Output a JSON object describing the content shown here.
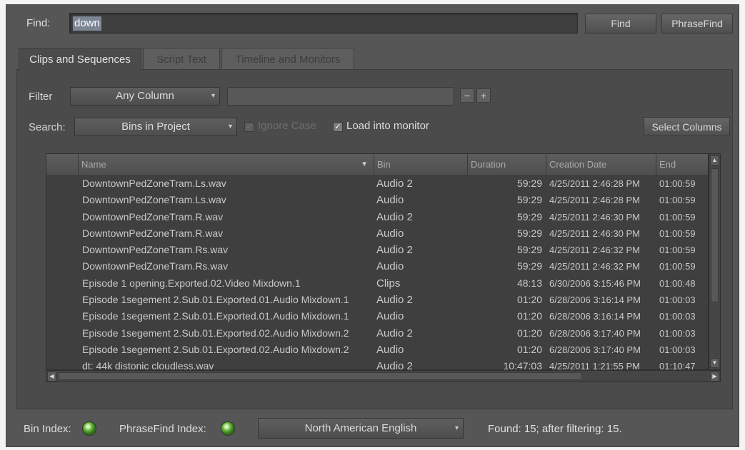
{
  "find": {
    "label": "Find:",
    "value": "down",
    "find_button": "Find",
    "phrasefind_button": "PhraseFind"
  },
  "tabs": [
    {
      "label": "Clips and Sequences",
      "active": true
    },
    {
      "label": "Script Text",
      "active": false
    },
    {
      "label": "Timeline and Monitors",
      "active": false
    }
  ],
  "filter": {
    "label": "Filter",
    "column": "Any Column",
    "text": "",
    "minus": "−",
    "plus": "+"
  },
  "search": {
    "label": "Search:",
    "scope": "Bins in Project",
    "ignore_case": "Ignore Case",
    "load_monitor": "Load into monitor",
    "select_columns": "Select Columns"
  },
  "table": {
    "headers": [
      "Name",
      "Bin",
      "Duration",
      "Creation Date",
      "End"
    ],
    "rows": [
      {
        "icon": "audio",
        "name": "DowntownPedZoneTram.Ls.wav",
        "bin": "Audio 2",
        "duration": "59:29",
        "date": "4/25/2011 2:46:28 PM",
        "end": "01:00:59"
      },
      {
        "icon": "audio",
        "name": "DowntownPedZoneTram.Ls.wav",
        "bin": "Audio",
        "duration": "59:29",
        "date": "4/25/2011 2:46:28 PM",
        "end": "01:00:59"
      },
      {
        "icon": "audio",
        "name": "DowntownPedZoneTram.R.wav",
        "bin": "Audio 2",
        "duration": "59:29",
        "date": "4/25/2011 2:46:30 PM",
        "end": "01:00:59"
      },
      {
        "icon": "audio",
        "name": "DowntownPedZoneTram.R.wav",
        "bin": "Audio",
        "duration": "59:29",
        "date": "4/25/2011 2:46:30 PM",
        "end": "01:00:59"
      },
      {
        "icon": "audio",
        "name": "DowntownPedZoneTram.Rs.wav",
        "bin": "Audio 2",
        "duration": "59:29",
        "date": "4/25/2011 2:46:32 PM",
        "end": "01:00:59"
      },
      {
        "icon": "audio",
        "name": "DowntownPedZoneTram.Rs.wav",
        "bin": "Audio",
        "duration": "59:29",
        "date": "4/25/2011 2:46:32 PM",
        "end": "01:00:59"
      },
      {
        "icon": "clip",
        "name": "Episode 1 opening.Exported.02.Video Mixdown.1",
        "bin": "Clips",
        "duration": "48:13",
        "date": "6/30/2006 3:15:46 PM",
        "end": "01:00:48"
      },
      {
        "icon": "audio",
        "name": "Episode 1segement 2.Sub.01.Exported.01.Audio Mixdown.1",
        "bin": "Audio 2",
        "duration": "01:20",
        "date": "6/28/2006 3:16:14 PM",
        "end": "01:00:03"
      },
      {
        "icon": "audio",
        "name": "Episode 1segement 2.Sub.01.Exported.01.Audio Mixdown.1",
        "bin": "Audio",
        "duration": "01:20",
        "date": "6/28/2006 3:16:14 PM",
        "end": "01:00:03"
      },
      {
        "icon": "audio",
        "name": "Episode 1segement 2.Sub.01.Exported.02.Audio Mixdown.2",
        "bin": "Audio 2",
        "duration": "01:20",
        "date": "6/28/2006 3:17:40 PM",
        "end": "01:00:03"
      },
      {
        "icon": "audio",
        "name": "Episode 1segement 2.Sub.01.Exported.02.Audio Mixdown.2",
        "bin": "Audio",
        "duration": "01:20",
        "date": "6/28/2006 3:17:40 PM",
        "end": "01:00:03"
      },
      {
        "icon": "audio",
        "name": "dt: 44k distonic cloudless.wav",
        "bin": "Audio 2",
        "duration": "10:47:03",
        "date": "4/25/2011 1:21:55 PM",
        "end": "01:10:47"
      }
    ]
  },
  "status": {
    "bin_index": "Bin Index:",
    "phrasefind_index": "PhraseFind Index:",
    "language": "North American English",
    "found": "Found: 15; after filtering: 15."
  },
  "colors": {
    "window_bg": "#565656",
    "panel_bg": "#4b4b4b",
    "table_bg": "#3f3f3f",
    "selection": "#7b8695",
    "led_green": "#6fc03f"
  }
}
